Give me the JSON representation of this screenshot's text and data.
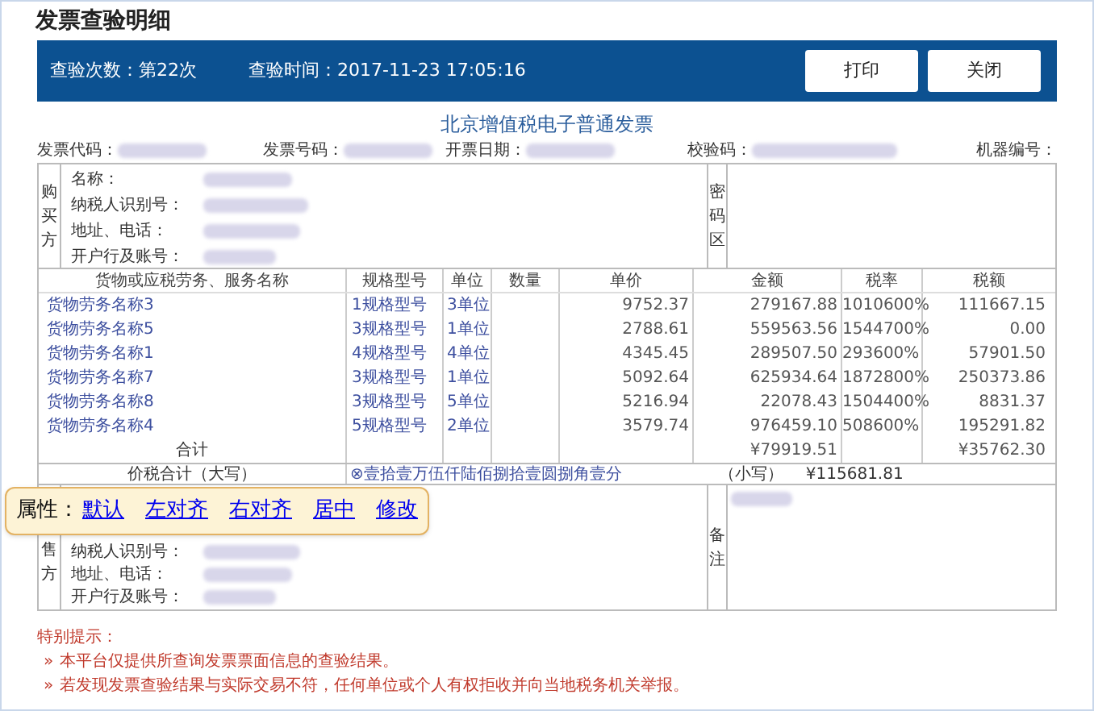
{
  "page_title": "发票查验明细",
  "summary": {
    "count": "查验次数：第22次",
    "time": "查验时间：2017-11-23 17:05:16"
  },
  "buttons": [
    "打印",
    "关闭"
  ],
  "invoice": {
    "title": "北京增值税电子普通发票",
    "header_fields": [
      {
        "label": "发票代码：",
        "redacted": true
      },
      {
        "label": "发票号码：",
        "redacted": true
      },
      {
        "label": "开票日期：",
        "redacted": true
      },
      {
        "label": "校验码：",
        "redacted": true
      },
      {
        "label": "机器编号：",
        "redacted": false
      }
    ],
    "buyer": {
      "label": "购买方",
      "fields": [
        "名称：",
        "纳税人识别号：",
        "地址、电话：",
        "开户行及账号："
      ]
    },
    "password_area_label": "密码区",
    "columns": [
      "货物或应税劳务、服务名称",
      "规格型号",
      "单位",
      "数量",
      "单价",
      "金额",
      "税率",
      "税额"
    ],
    "rows": [
      {
        "name": "货物劳务名称3",
        "spec": "1规格型号",
        "unit": "3单位",
        "price": "9752.37",
        "amount": "279167.88",
        "rate": "1010600%",
        "tax": "111667.15"
      },
      {
        "name": "货物劳务名称5",
        "spec": "3规格型号",
        "unit": "1单位",
        "price": "2788.61",
        "amount": "559563.56",
        "rate": "1544700%",
        "tax": "0.00"
      },
      {
        "name": "货物劳务名称1",
        "spec": "4规格型号",
        "unit": "4单位",
        "price": "4345.45",
        "amount": "289507.50",
        "rate": "293600%",
        "tax": "57901.50"
      },
      {
        "name": "货物劳务名称7",
        "spec": "3规格型号",
        "unit": "1单位",
        "price": "5092.64",
        "amount": "625934.64",
        "rate": "1872800%",
        "tax": "250373.86"
      },
      {
        "name": "货物劳务名称8",
        "spec": "3规格型号",
        "unit": "5单位",
        "price": "5216.94",
        "amount": "22078.43",
        "rate": "1504400%",
        "tax": "8831.37"
      },
      {
        "name": "货物劳务名称4",
        "spec": "5规格型号",
        "unit": "2单位",
        "price": "3579.74",
        "amount": "976459.10",
        "rate": "508600%",
        "tax": "195291.82"
      }
    ],
    "total": {
      "label": "合计",
      "amount": "¥79919.51",
      "tax": "¥35762.30"
    },
    "grand_total": {
      "label": "价税合计（大写）",
      "words": "⊗壹拾壹万伍仟陆佰捌拾壹圆捌角壹分",
      "small_label": "（小写）",
      "small_value": "¥115681.81"
    },
    "seller": {
      "label": "售方",
      "fields": [
        "纳税人识别号：",
        "地址、电话：",
        "开户行及账号："
      ]
    },
    "remarks_label": "备注"
  },
  "notes": {
    "title": "特别提示：",
    "items": [
      {
        "marker": "»",
        "text": "本平台仅提供所查询发票票面信息的查验结果。"
      },
      {
        "marker": "»",
        "text": "若发现发票查验结果与实际交易不符，任何单位或个人有权拒收并向当地税务机关举报。"
      }
    ]
  },
  "property_popup": {
    "label": "属性：",
    "links": [
      "默认",
      "左对齐",
      "右对齐",
      "居中",
      "修改"
    ]
  }
}
